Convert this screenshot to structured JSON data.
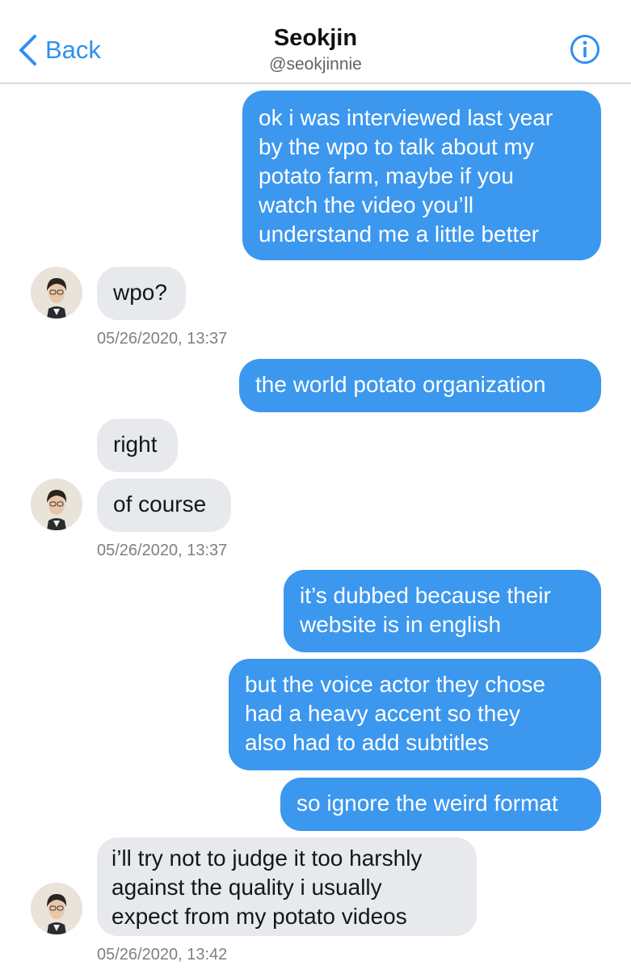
{
  "header": {
    "back_label": "Back",
    "title": "Seokjin",
    "handle": "@seokjinnie",
    "back_icon": "chevron-left-icon",
    "info_icon": "info-icon"
  },
  "colors": {
    "accent": "#2f8ff2",
    "outgoing_bubble": "#3c97ee",
    "incoming_bubble": "#e7e9ed"
  },
  "messages": [
    {
      "from": "me",
      "text": "ok i was interviewed last year\nby the wpo to talk about my\npotato farm, maybe if you\nwatch the video you’ll\nunderstand me a little better"
    },
    {
      "from": "them",
      "text": "wpo?"
    },
    {
      "from": "me",
      "text": "the world potato organization"
    },
    {
      "from": "them",
      "text": "right"
    },
    {
      "from": "them",
      "text": "of course"
    },
    {
      "from": "me",
      "text": "it’s dubbed because their\nwebsite is in english"
    },
    {
      "from": "me",
      "text": "but the voice actor they chose\nhad a heavy accent so they\nalso had to add subtitles"
    },
    {
      "from": "me",
      "text": "so ignore the weird format"
    },
    {
      "from": "them",
      "text": "i’ll try not to judge it too harshly\nagainst the quality i usually\nexpect from my potato videos"
    }
  ],
  "timestamps": [
    "05/26/2020, 13:37",
    "05/26/2020, 13:37",
    "05/26/2020, 13:42"
  ]
}
